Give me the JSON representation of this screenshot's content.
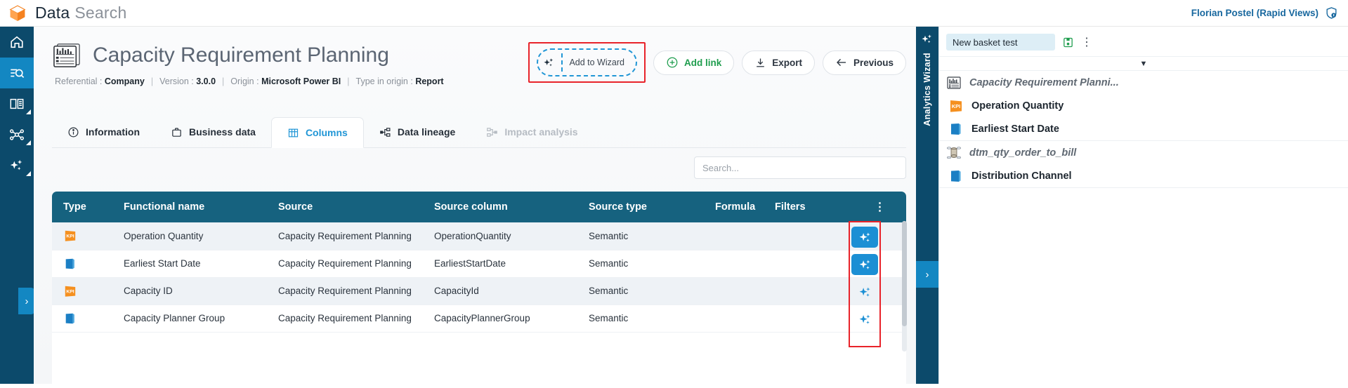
{
  "topbar": {
    "brand_primary": "Data",
    "brand_secondary": "Search",
    "logo_icon": "cube-icon",
    "user_name": "Florian Postel (Rapid Views)",
    "user_icon": "shield-lock-icon"
  },
  "leftnav": {
    "items": [
      {
        "name": "home",
        "icon": "home-icon",
        "active": false,
        "corner": false
      },
      {
        "name": "data-search",
        "icon": "search-list-icon",
        "active": true,
        "corner": false
      },
      {
        "name": "glossary",
        "icon": "book-icon",
        "active": false,
        "corner": true
      },
      {
        "name": "data-graph",
        "icon": "network-icon",
        "active": false,
        "corner": true
      },
      {
        "name": "ai-assistant",
        "icon": "sparkles-icon",
        "active": false,
        "corner": true
      }
    ],
    "expand_label": "›"
  },
  "page": {
    "title": "Capacity Requirement Planning",
    "title_icon": "report-chart-icon",
    "meta": [
      {
        "label": "Referential :",
        "value": "Company"
      },
      {
        "label": "Version :",
        "value": "3.0.0"
      },
      {
        "label": "Origin :",
        "value": "Microsoft Power BI"
      },
      {
        "label": "Type in origin :",
        "value": "Report"
      }
    ],
    "meta_separator": "|"
  },
  "toolbar": {
    "wizard_label": "Add to Wizard",
    "wizard_icon": "sparkles-icon",
    "add_link_label": "Add link",
    "add_link_icon": "plus-circle-icon",
    "export_label": "Export",
    "export_icon": "download-icon",
    "previous_label": "Previous",
    "previous_icon": "arrow-left-icon",
    "highlight_color": "#e8232a"
  },
  "tabs": [
    {
      "label": "Information",
      "icon": "info-icon",
      "state": "normal"
    },
    {
      "label": "Business data",
      "icon": "briefcase-icon",
      "state": "normal"
    },
    {
      "label": "Columns",
      "icon": "grid-icon",
      "state": "active"
    },
    {
      "label": "Data lineage",
      "icon": "lineage-icon",
      "state": "normal"
    },
    {
      "label": "Impact analysis",
      "icon": "impact-icon",
      "state": "disabled"
    }
  ],
  "search": {
    "placeholder": "Search..."
  },
  "table": {
    "columns": [
      "Type",
      "Functional name",
      "Source",
      "Source column",
      "Source type",
      "Formula",
      "Filters"
    ],
    "menu_icon": "kebab-menu-icon",
    "rows": [
      {
        "type_icon": "kpi-icon",
        "functional_name": "Operation Quantity",
        "source": "Capacity Requirement Planning",
        "source_column": "OperationQuantity",
        "source_type": "Semantic",
        "formula": "",
        "filters": "",
        "action_icon": "sparkles-icon",
        "action_state": "filled"
      },
      {
        "type_icon": "attribute-icon",
        "functional_name": "Earliest Start Date",
        "source": "Capacity Requirement Planning",
        "source_column": "EarliestStartDate",
        "source_type": "Semantic",
        "formula": "",
        "filters": "",
        "action_icon": "sparkles-icon",
        "action_state": "filled"
      },
      {
        "type_icon": "kpi-icon",
        "functional_name": "Capacity ID",
        "source": "Capacity Requirement Planning",
        "source_column": "CapacityId",
        "source_type": "Semantic",
        "formula": "",
        "filters": "",
        "action_icon": "sparkles-icon",
        "action_state": "plain"
      },
      {
        "type_icon": "attribute-icon",
        "functional_name": "Capacity Planner Group",
        "source": "Capacity Requirement Planning",
        "source_column": "CapacityPlannerGroup",
        "source_type": "Semantic",
        "formula": "",
        "filters": "",
        "action_icon": "sparkles-icon",
        "action_state": "plain"
      }
    ]
  },
  "wizard": {
    "rail_label": "Analytics Wizard",
    "rail_icon": "sparkles-icon",
    "toggle_label": "›",
    "basket_name": "New basket test",
    "save_icon": "save-icon",
    "kebab_icon": "kebab-menu-icon",
    "collapse_icon": "▼",
    "groups": [
      {
        "header": {
          "label": "Capacity Requirement Planni...",
          "icon": "report-chart-icon"
        },
        "items": [
          {
            "label": "Operation Quantity",
            "icon": "kpi-icon"
          },
          {
            "label": "Earliest Start Date",
            "icon": "attribute-icon"
          }
        ]
      },
      {
        "header": {
          "label": "dtm_qty_order_to_bill",
          "icon": "dataset-icon"
        },
        "items": [
          {
            "label": "Distribution Channel",
            "icon": "attribute-icon"
          }
        ]
      }
    ]
  }
}
